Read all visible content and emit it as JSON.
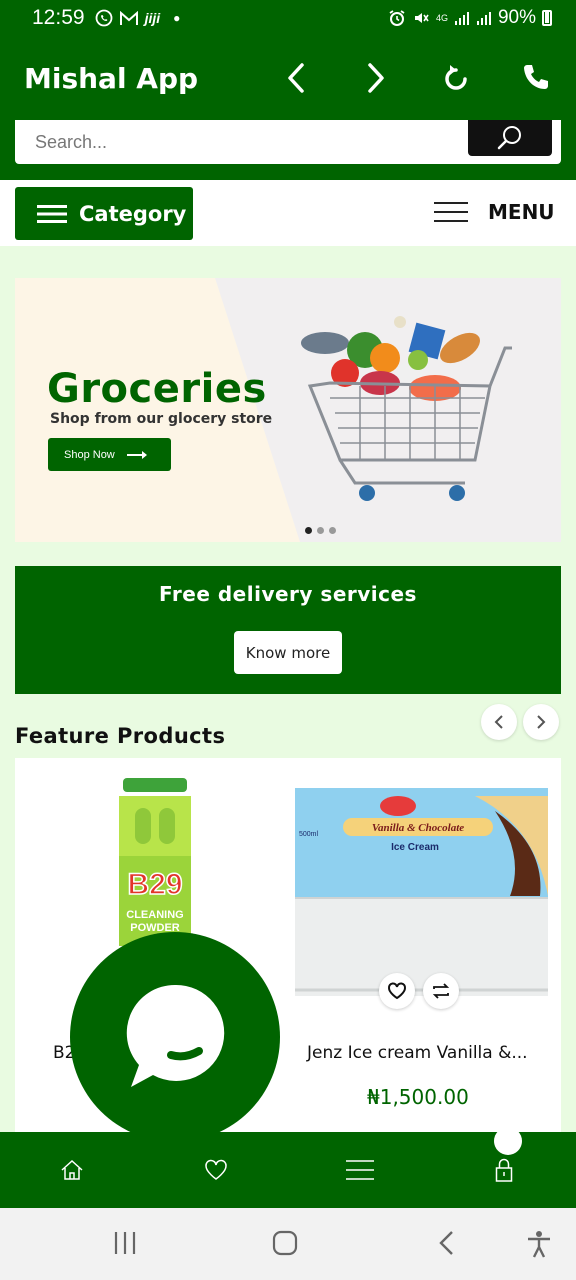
{
  "status_bar": {
    "time": "12:59",
    "notifications": [
      "whatsapp-icon",
      "gmail-icon",
      "jiji-icon",
      "dot"
    ],
    "jiji": "jiji",
    "battery": "90%",
    "signal": "4G"
  },
  "app_bar": {
    "title": "Mishal App",
    "actions": [
      "back-icon",
      "forward-icon",
      "reload-icon",
      "phone-icon"
    ]
  },
  "search": {
    "placeholder": "Search..."
  },
  "category": {
    "label": "Category",
    "menu_label": "MENU"
  },
  "banner": {
    "title": "Groceries",
    "subtitle": "Shop from our glocery store",
    "button": "Shop Now",
    "slide_count": 3,
    "active_slide": 1
  },
  "delivery": {
    "title": "Free delivery services",
    "button": "Know more"
  },
  "featured": {
    "title": "Feature Products",
    "products": [
      {
        "name": "B2",
        "price": "",
        "image": "B29 cleaning powder"
      },
      {
        "name": "Jenz Ice cream Vanilla &...",
        "price": "₦1,500.00",
        "image": "Vanilla & Chocolate Ice Cream"
      }
    ]
  },
  "product_image_text": {
    "b29": "B29",
    "b29_sub": "CLEANING",
    "b29_sub2": "POWDER",
    "ice_label": "Vanilla & Chocolate",
    "ice_sub": "Ice Cream",
    "ice_size": "500ml"
  },
  "bottom_nav": [
    "home-icon",
    "heart-icon",
    "menu-icon",
    "lock-icon"
  ],
  "colors": {
    "primary": "#006400",
    "page_bg": "#e9fbe1",
    "banner_bg": "#f1eff0",
    "banner_left": "#fdf5e6"
  }
}
